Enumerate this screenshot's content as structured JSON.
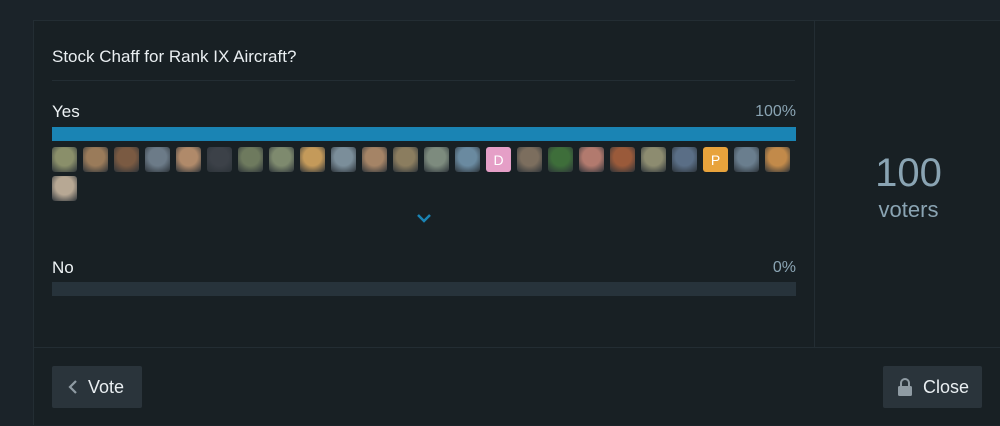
{
  "poll": {
    "question": "Stock Chaff for Rank IX Aircraft?",
    "options": [
      {
        "label": "Yes",
        "percent_text": "100%",
        "fill": 1.0
      },
      {
        "label": "No",
        "percent_text": "0%",
        "fill": 0.0
      }
    ],
    "voters": {
      "count": "100",
      "label": "voters"
    }
  },
  "avatars": [
    {
      "type": "image",
      "color": "#8a8f6a"
    },
    {
      "type": "image",
      "color": "#9a7b5a"
    },
    {
      "type": "image",
      "color": "#7a5a42"
    },
    {
      "type": "image",
      "color": "#6c7b88"
    },
    {
      "type": "image",
      "color": "#b08a6a"
    },
    {
      "type": "image",
      "color": "#3c4148"
    },
    {
      "type": "image",
      "color": "#6e7a5e"
    },
    {
      "type": "image",
      "color": "#7e8a6e"
    },
    {
      "type": "image",
      "color": "#c49a5a"
    },
    {
      "type": "image",
      "color": "#7b8e9a"
    },
    {
      "type": "image",
      "color": "#a58466"
    },
    {
      "type": "image",
      "color": "#8b7d5f"
    },
    {
      "type": "image",
      "color": "#7d8b7e"
    },
    {
      "type": "image",
      "color": "#6a8aa0"
    },
    {
      "type": "letter",
      "letter": "D",
      "color": "#e59fc7"
    },
    {
      "type": "image",
      "color": "#7c6e5e"
    },
    {
      "type": "image",
      "color": "#3e6e3a"
    },
    {
      "type": "image",
      "color": "#b27a6e"
    },
    {
      "type": "image",
      "color": "#9a5a3a"
    },
    {
      "type": "image",
      "color": "#8d8c70"
    },
    {
      "type": "image",
      "color": "#5a6e86"
    },
    {
      "type": "letter",
      "letter": "P",
      "color": "#e8a33c"
    },
    {
      "type": "image",
      "color": "#6a7e8e"
    },
    {
      "type": "image",
      "color": "#c28a4a"
    },
    {
      "type": "image",
      "color": "#b7a894"
    }
  ],
  "buttons": {
    "vote": "Vote",
    "close": "Close"
  },
  "icons": {
    "expand": "chevron-down-icon",
    "back": "chevron-left-icon",
    "lock": "lock-icon"
  },
  "colors": {
    "accent": "#1a84b4"
  }
}
